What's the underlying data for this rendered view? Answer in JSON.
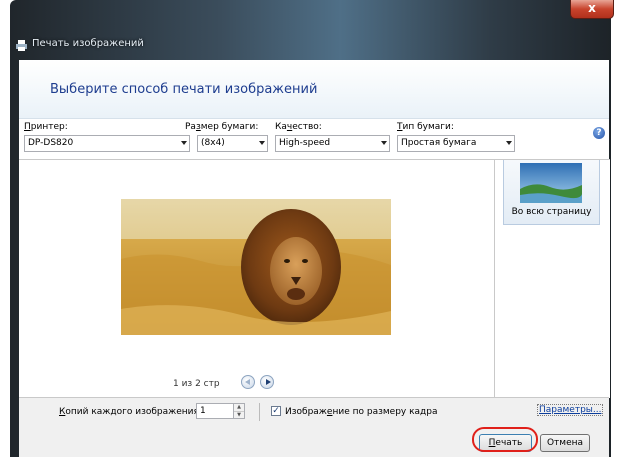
{
  "window": {
    "title": "Печать изображений",
    "close_label": "x"
  },
  "header": {
    "title": "Выберите способ печати изображений"
  },
  "options": {
    "printer": {
      "label_underlined": "П",
      "label_rest": "ринтер:",
      "value": "DP-DS820"
    },
    "paper_size": {
      "label_pre": "Ра",
      "label_underlined": "з",
      "label_rest": "мер бумаги:",
      "value": "(8x4)"
    },
    "quality": {
      "label_pre": "Ка",
      "label_underlined": "ч",
      "label_rest": "ество:",
      "value": "High-speed"
    },
    "paper_type": {
      "label_underlined": "Т",
      "label_rest": "ип бумаги:",
      "value": "Простая бумага"
    }
  },
  "help_icon": "?",
  "preview": {
    "page_counter": "1 из 2 стр",
    "image_icon": "lion-photo"
  },
  "layout": {
    "item_label": "Во всю страницу"
  },
  "copies": {
    "label_underlined": "К",
    "label_rest": "опий каждого изображения:",
    "value": "1"
  },
  "fit_to_frame": {
    "checked": true,
    "label_pre": "Изображ",
    "label_underlined": "е",
    "label_rest": "ние по размеру кадра"
  },
  "options_link": "Параметры...",
  "buttons": {
    "print_underlined": "П",
    "print_rest": "ечать",
    "cancel": "Отмена"
  },
  "colors": {
    "header_title": "#1e3d8f",
    "highlight": "#e0201a",
    "link": "#0b3d9c"
  }
}
